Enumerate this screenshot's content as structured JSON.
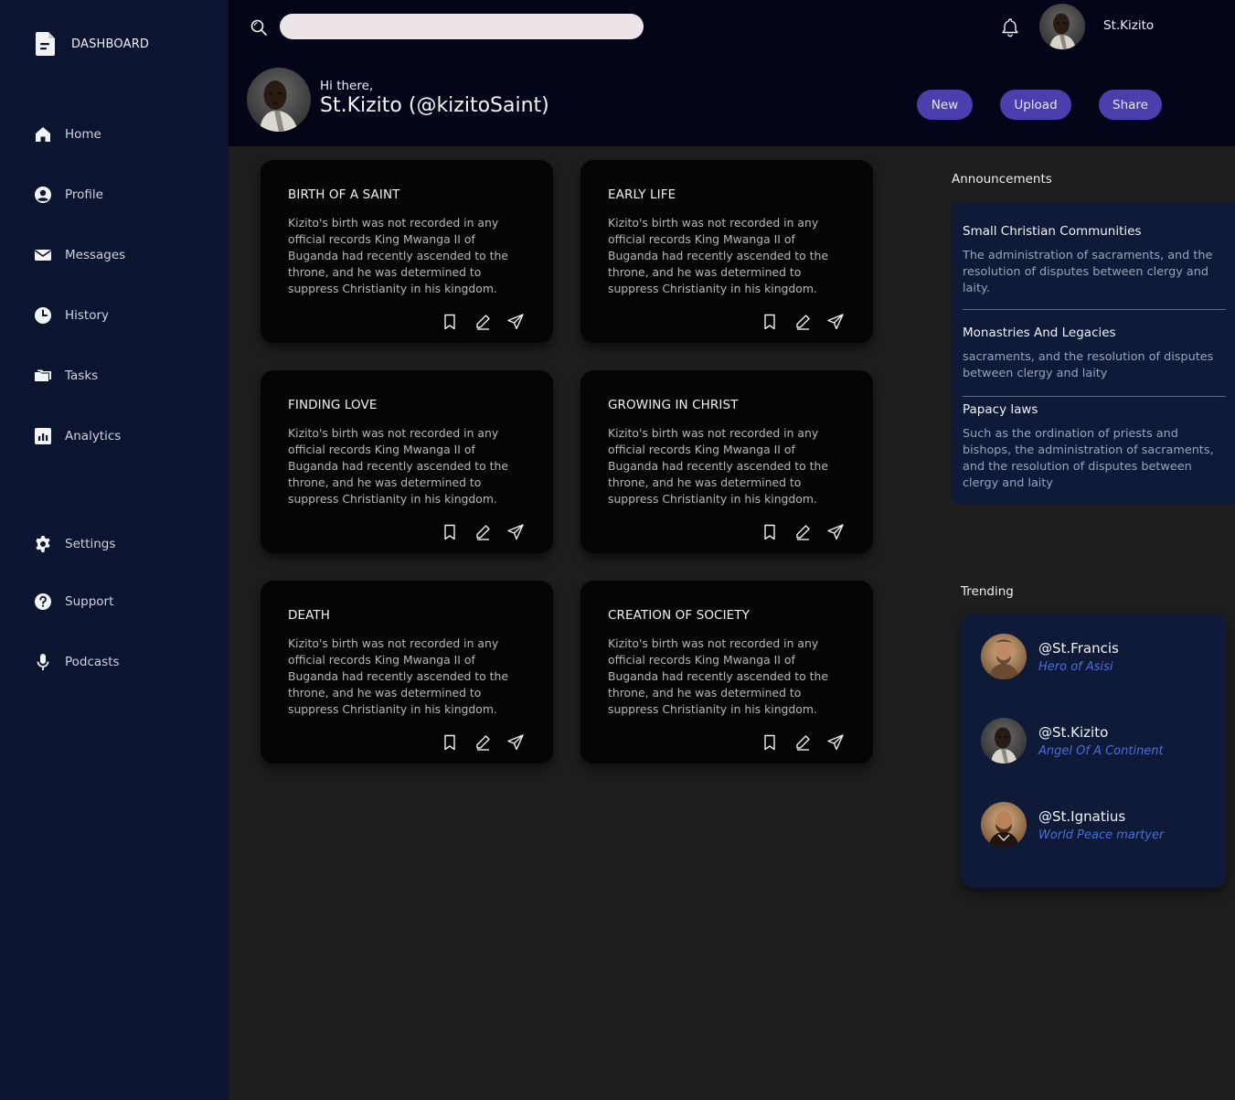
{
  "sidebar": {
    "brand_label": "DASHBOARD",
    "items": [
      {
        "label": "Home",
        "icon": "home-icon"
      },
      {
        "label": "Profile",
        "icon": "user-circle-icon"
      },
      {
        "label": "Messages",
        "icon": "envelope-icon"
      },
      {
        "label": "History",
        "icon": "clock-icon"
      },
      {
        "label": "Tasks",
        "icon": "folders-icon"
      },
      {
        "label": "Analytics",
        "icon": "bar-chart-icon"
      },
      {
        "label": "Settings",
        "icon": "gear-icon"
      },
      {
        "label": "Support",
        "icon": "help-circle-icon"
      },
      {
        "label": "Podcasts",
        "icon": "microphone-icon"
      }
    ]
  },
  "header": {
    "search_placeholder": "",
    "user_name": "St.Kizito",
    "greeting": "Hi there,",
    "profile_handle": "St.Kizito (@kizitoSaint)",
    "buttons": {
      "new": "New",
      "upload": "Upload",
      "share": "Share"
    }
  },
  "cards": [
    {
      "title": "BIRTH OF A SAINT",
      "body": "Kizito's birth was not recorded in any official records King Mwanga II of Buganda had recently ascended to the throne, and he was determined to suppress Christianity in his kingdom."
    },
    {
      "title": "EARLY LIFE",
      "body": "Kizito's birth was not recorded in any official records King Mwanga II of Buganda had recently ascended to the throne, and he was determined to suppress Christianity in his kingdom."
    },
    {
      "title": "FINDING LOVE",
      "body": "Kizito's birth was not recorded in any official records King Mwanga II of Buganda had recently ascended to the throne, and he was determined to suppress Christianity in his kingdom."
    },
    {
      "title": "GROWING IN CHRIST",
      "body": "Kizito's birth was not recorded in any official records King Mwanga II of Buganda had recently ascended to the throne, and he was determined to suppress Christianity in his kingdom."
    },
    {
      "title": "DEATH",
      "body": "Kizito's birth was not recorded in any official records King Mwanga II of Buganda had recently ascended to the throne, and he was determined to suppress Christianity in his kingdom."
    },
    {
      "title": "CREATION OF SOCIETY",
      "body": "Kizito's birth was not recorded in any official records King Mwanga II of Buganda had recently ascended to the throne, and he was determined to suppress Christianity in his kingdom."
    }
  ],
  "announcements": {
    "title": "Announcements",
    "items": [
      {
        "title": "Small Christian Communities",
        "body": "The administration of sacraments, and the resolution of disputes between clergy and laity."
      },
      {
        "title": "Monastries And Legacies",
        "body": "sacraments, and the resolution of disputes between clergy and laity"
      },
      {
        "title": "Papacy laws",
        "body": "Such as the ordination of priests and bishops, the administration of sacraments, and the resolution of disputes between clergy and laity"
      }
    ]
  },
  "trending": {
    "title": "Trending",
    "items": [
      {
        "handle": "@St.Francis",
        "subtitle": "Hero of Asisi"
      },
      {
        "handle": "@St.Kizito",
        "subtitle": "Angel Of A Continent"
      },
      {
        "handle": "@St.Ignatius",
        "subtitle": "World Peace martyer"
      }
    ]
  },
  "colors": {
    "sidebar_bg": "#0b1530",
    "header_bg": "#020618",
    "main_bg": "#1e1e1e",
    "card_bg": "#050505",
    "panel_bg": "#0e1a38",
    "accent_button": "#4b3fad",
    "trending_subtitle": "#4a6fd6"
  }
}
